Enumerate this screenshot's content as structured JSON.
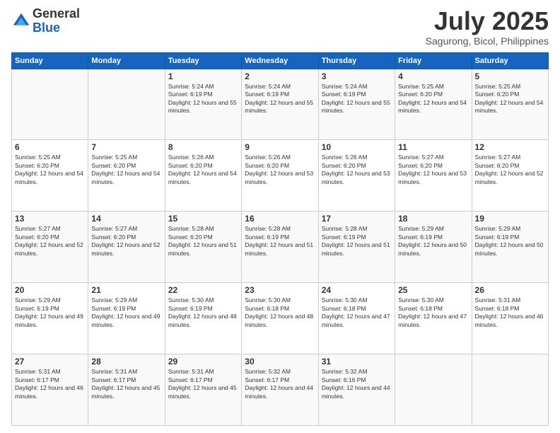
{
  "logo": {
    "general": "General",
    "blue": "Blue"
  },
  "title": "July 2025",
  "location": "Sagurong, Bicol, Philippines",
  "days_of_week": [
    "Sunday",
    "Monday",
    "Tuesday",
    "Wednesday",
    "Thursday",
    "Friday",
    "Saturday"
  ],
  "weeks": [
    [
      {
        "day": "",
        "sunrise": "",
        "sunset": "",
        "daylight": ""
      },
      {
        "day": "",
        "sunrise": "",
        "sunset": "",
        "daylight": ""
      },
      {
        "day": "1",
        "sunrise": "Sunrise: 5:24 AM",
        "sunset": "Sunset: 6:19 PM",
        "daylight": "Daylight: 12 hours and 55 minutes."
      },
      {
        "day": "2",
        "sunrise": "Sunrise: 5:24 AM",
        "sunset": "Sunset: 6:19 PM",
        "daylight": "Daylight: 12 hours and 55 minutes."
      },
      {
        "day": "3",
        "sunrise": "Sunrise: 5:24 AM",
        "sunset": "Sunset: 6:19 PM",
        "daylight": "Daylight: 12 hours and 55 minutes."
      },
      {
        "day": "4",
        "sunrise": "Sunrise: 5:25 AM",
        "sunset": "Sunset: 6:20 PM",
        "daylight": "Daylight: 12 hours and 54 minutes."
      },
      {
        "day": "5",
        "sunrise": "Sunrise: 5:25 AM",
        "sunset": "Sunset: 6:20 PM",
        "daylight": "Daylight: 12 hours and 54 minutes."
      }
    ],
    [
      {
        "day": "6",
        "sunrise": "Sunrise: 5:25 AM",
        "sunset": "Sunset: 6:20 PM",
        "daylight": "Daylight: 12 hours and 54 minutes."
      },
      {
        "day": "7",
        "sunrise": "Sunrise: 5:25 AM",
        "sunset": "Sunset: 6:20 PM",
        "daylight": "Daylight: 12 hours and 54 minutes."
      },
      {
        "day": "8",
        "sunrise": "Sunrise: 5:26 AM",
        "sunset": "Sunset: 6:20 PM",
        "daylight": "Daylight: 12 hours and 54 minutes."
      },
      {
        "day": "9",
        "sunrise": "Sunrise: 5:26 AM",
        "sunset": "Sunset: 6:20 PM",
        "daylight": "Daylight: 12 hours and 53 minutes."
      },
      {
        "day": "10",
        "sunrise": "Sunrise: 5:26 AM",
        "sunset": "Sunset: 6:20 PM",
        "daylight": "Daylight: 12 hours and 53 minutes."
      },
      {
        "day": "11",
        "sunrise": "Sunrise: 5:27 AM",
        "sunset": "Sunset: 6:20 PM",
        "daylight": "Daylight: 12 hours and 53 minutes."
      },
      {
        "day": "12",
        "sunrise": "Sunrise: 5:27 AM",
        "sunset": "Sunset: 6:20 PM",
        "daylight": "Daylight: 12 hours and 52 minutes."
      }
    ],
    [
      {
        "day": "13",
        "sunrise": "Sunrise: 5:27 AM",
        "sunset": "Sunset: 6:20 PM",
        "daylight": "Daylight: 12 hours and 52 minutes."
      },
      {
        "day": "14",
        "sunrise": "Sunrise: 5:27 AM",
        "sunset": "Sunset: 6:20 PM",
        "daylight": "Daylight: 12 hours and 52 minutes."
      },
      {
        "day": "15",
        "sunrise": "Sunrise: 5:28 AM",
        "sunset": "Sunset: 6:20 PM",
        "daylight": "Daylight: 12 hours and 51 minutes."
      },
      {
        "day": "16",
        "sunrise": "Sunrise: 5:28 AM",
        "sunset": "Sunset: 6:19 PM",
        "daylight": "Daylight: 12 hours and 51 minutes."
      },
      {
        "day": "17",
        "sunrise": "Sunrise: 5:28 AM",
        "sunset": "Sunset: 6:19 PM",
        "daylight": "Daylight: 12 hours and 51 minutes."
      },
      {
        "day": "18",
        "sunrise": "Sunrise: 5:29 AM",
        "sunset": "Sunset: 6:19 PM",
        "daylight": "Daylight: 12 hours and 50 minutes."
      },
      {
        "day": "19",
        "sunrise": "Sunrise: 5:29 AM",
        "sunset": "Sunset: 6:19 PM",
        "daylight": "Daylight: 12 hours and 50 minutes."
      }
    ],
    [
      {
        "day": "20",
        "sunrise": "Sunrise: 5:29 AM",
        "sunset": "Sunset: 6:19 PM",
        "daylight": "Daylight: 12 hours and 49 minutes."
      },
      {
        "day": "21",
        "sunrise": "Sunrise: 5:29 AM",
        "sunset": "Sunset: 6:19 PM",
        "daylight": "Daylight: 12 hours and 49 minutes."
      },
      {
        "day": "22",
        "sunrise": "Sunrise: 5:30 AM",
        "sunset": "Sunset: 6:19 PM",
        "daylight": "Daylight: 12 hours and 48 minutes."
      },
      {
        "day": "23",
        "sunrise": "Sunrise: 5:30 AM",
        "sunset": "Sunset: 6:18 PM",
        "daylight": "Daylight: 12 hours and 48 minutes."
      },
      {
        "day": "24",
        "sunrise": "Sunrise: 5:30 AM",
        "sunset": "Sunset: 6:18 PM",
        "daylight": "Daylight: 12 hours and 47 minutes."
      },
      {
        "day": "25",
        "sunrise": "Sunrise: 5:30 AM",
        "sunset": "Sunset: 6:18 PM",
        "daylight": "Daylight: 12 hours and 47 minutes."
      },
      {
        "day": "26",
        "sunrise": "Sunrise: 5:31 AM",
        "sunset": "Sunset: 6:18 PM",
        "daylight": "Daylight: 12 hours and 46 minutes."
      }
    ],
    [
      {
        "day": "27",
        "sunrise": "Sunrise: 5:31 AM",
        "sunset": "Sunset: 6:17 PM",
        "daylight": "Daylight: 12 hours and 46 minutes."
      },
      {
        "day": "28",
        "sunrise": "Sunrise: 5:31 AM",
        "sunset": "Sunset: 6:17 PM",
        "daylight": "Daylight: 12 hours and 45 minutes."
      },
      {
        "day": "29",
        "sunrise": "Sunrise: 5:31 AM",
        "sunset": "Sunset: 6:17 PM",
        "daylight": "Daylight: 12 hours and 45 minutes."
      },
      {
        "day": "30",
        "sunrise": "Sunrise: 5:32 AM",
        "sunset": "Sunset: 6:17 PM",
        "daylight": "Daylight: 12 hours and 44 minutes."
      },
      {
        "day": "31",
        "sunrise": "Sunrise: 5:32 AM",
        "sunset": "Sunset: 6:16 PM",
        "daylight": "Daylight: 12 hours and 44 minutes."
      },
      {
        "day": "",
        "sunrise": "",
        "sunset": "",
        "daylight": ""
      },
      {
        "day": "",
        "sunrise": "",
        "sunset": "",
        "daylight": ""
      }
    ]
  ]
}
